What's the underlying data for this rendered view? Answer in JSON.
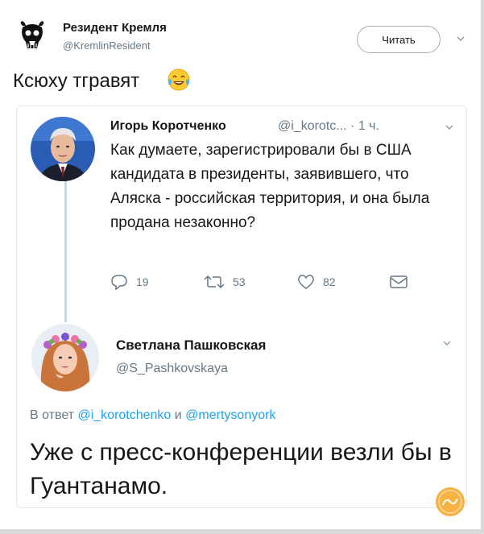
{
  "tweet": {
    "author_name": "Резидент Кремля",
    "author_handle": "@KremlinResident",
    "follow_label": "Читать",
    "text": "Ксюху тгравят"
  },
  "quoted_tweet": {
    "author_name": "Игорь Коротченко",
    "author_handle_time": "@i_korotc... · 1 ч.",
    "text": "Как думаете, зарегистрировали бы в США кандидата в президенты, заявившего, что Аляска - российская территория, и она была продана незаконно?",
    "replies": "19",
    "retweets": "53",
    "likes": "82"
  },
  "reply_tweet": {
    "author_name": "Светлана Пашковская",
    "author_handle": "@S_Pashkovskaya",
    "reply_prefix": "В ответ",
    "reply_mention_1": "@i_korotchenko",
    "reply_and": "и",
    "reply_mention_2": "@mertysonyork",
    "text": "Уже с пресс-конференции везли бы в Гуантанамо."
  },
  "colors": {
    "link": "#1da1f2",
    "secondary_text": "#657786",
    "border": "#e1e8ed",
    "watermark": "#f5a623"
  },
  "icons": {
    "reply": "reply-icon",
    "retweet": "retweet-icon",
    "like": "heart-icon",
    "dm": "envelope-icon",
    "emoji": "crying-laughing-emoji",
    "menu": "chevron-down-icon"
  }
}
